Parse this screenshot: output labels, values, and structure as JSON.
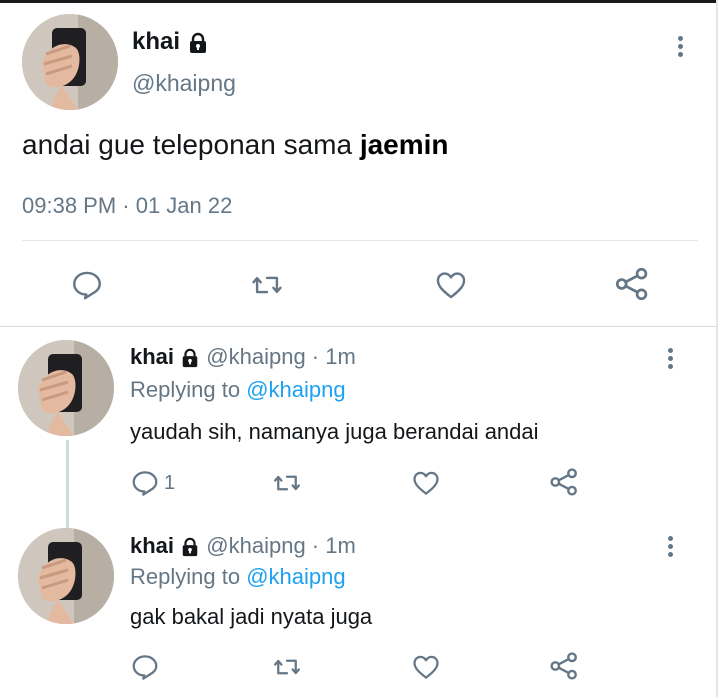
{
  "main_tweet": {
    "author_name": "khai",
    "handle": "@khaipng",
    "text": "andai gue teleponan sama",
    "text_emphasis": "jaemin",
    "timestamp": "09:38 PM · 01 Jan 22",
    "actions": [
      "reply-icon",
      "retweet-icon",
      "like-icon",
      "share-icon"
    ]
  },
  "replies": [
    {
      "author_name": "khai",
      "handle_time": "@khaipng · 1m",
      "replying_prefix": "Replying to",
      "replying_to": "@khaipng",
      "text": "yaudah sih, namanya juga berandai andai",
      "reply_count": "1"
    },
    {
      "author_name": "khai",
      "handle_time": "@khaipng · 1m",
      "replying_prefix": "Replying to",
      "replying_to": "@khaipng",
      "text": "gak bakal jadi nyata juga",
      "reply_count": ""
    }
  ],
  "colors": {
    "text": "#14171a",
    "muted": "#657786",
    "link": "#1da1f2",
    "divider": "#e1e8ed"
  }
}
